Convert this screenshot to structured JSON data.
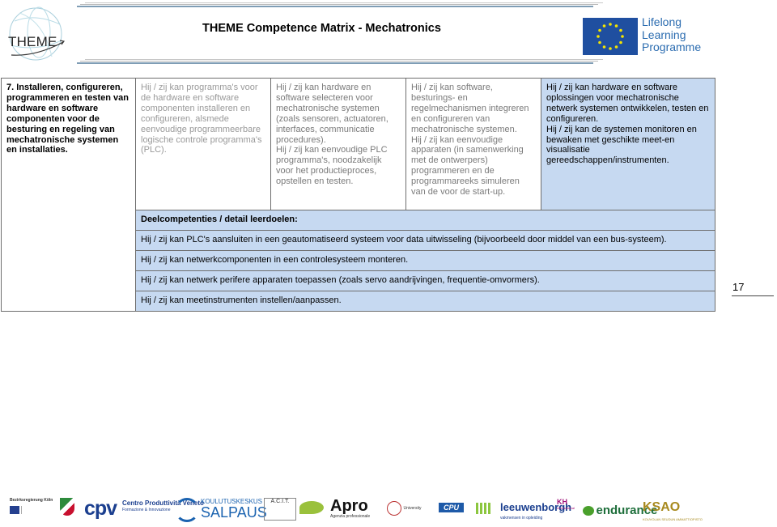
{
  "header": {
    "logo_text": "THEME",
    "title": "THEME Competence Matrix - Mechatronics",
    "eu_logo_lines": [
      "Lifelong",
      "Learning",
      "Programme"
    ]
  },
  "matrix": {
    "competence_area": "7. Installeren, configureren, programmeren en testen van hardware en software componenten voor de besturing en regeling van mechatronische systemen en installaties.",
    "levels": [
      "Hij / zij kan programma's voor de hardware en software componenten  installeren en configureren,  alsmede eenvoudige programmeerbare logische controle programma's (PLC).",
      "Hij / zij kan hardware en software selecteren voor mechatronische systemen (zoals sensoren, actuatoren, interfaces, communicatie procedures).\nHij / zij kan  eenvoudige PLC programma's,  noodzakelijk voor het productieproces, opstellen en testen.",
      "Hij / zij kan software, besturings- en regelmechanismen  integreren en configureren van mechatronische systemen.\nHij / zij kan  eenvoudige apparaten (in samenwerking met de ontwerpers) programmeren en de programmareeks simuleren van de voor de start-up.",
      "Hij / zij kan hardware en software oplossingen voor mechatronische netwerk systemen ontwikkelen, testen en configureren.\nHij / zij kan de systemen monitoren en bewaken met geschikte meet-en visualisatie gereedschappen/instrumenten."
    ],
    "sub_heading": "Deelcompetenties / detail leerdoelen:",
    "sub_items": [
      "Hij / zij kan PLC's aansluiten in een geautomatiseerd systeem voor data uitwisseling (bijvoorbeeld door middel van een bus-systeem).",
      "Hij / zij kan netwerkcomponenten in een controlesysteem monteren.",
      "Hij / zij kan netwerk perifere apparaten toepassen (zoals servo aandrijvingen, frequentie-omvormers).",
      "Hij / zij kan meetinstrumenten instellen/aanpassen."
    ]
  },
  "page_number": "17",
  "footer": {
    "sponsors": [
      "Bezirksregierung Köln",
      "CPV",
      "Centro Produttività Veneto",
      "KOULUTUSKESKUS SALPAUS",
      "A.C.I.T.",
      "Apro",
      "University",
      "CPU",
      "leeuwenborgh",
      "KH International",
      "endurance",
      "KSAO"
    ],
    "sponsor_sublines": {
      "cpv_sub": "Formazione & Innovazione",
      "salpaus_top": "KOULUTUSKESKUS",
      "salpaus_main": "SALPAUS",
      "apro_sub": "Agenzia professionale",
      "leeuwen_sub": "vakmensen in opleiding",
      "ksao_sub": "KOUVOLAN SEUDUN AMMATTIOPISTO"
    }
  },
  "colors": {
    "blue_cell": "#c6d9f1",
    "eu_blue": "#1f4fa0",
    "eu_text": "#2b6cb0",
    "grey_text": "#999999"
  }
}
